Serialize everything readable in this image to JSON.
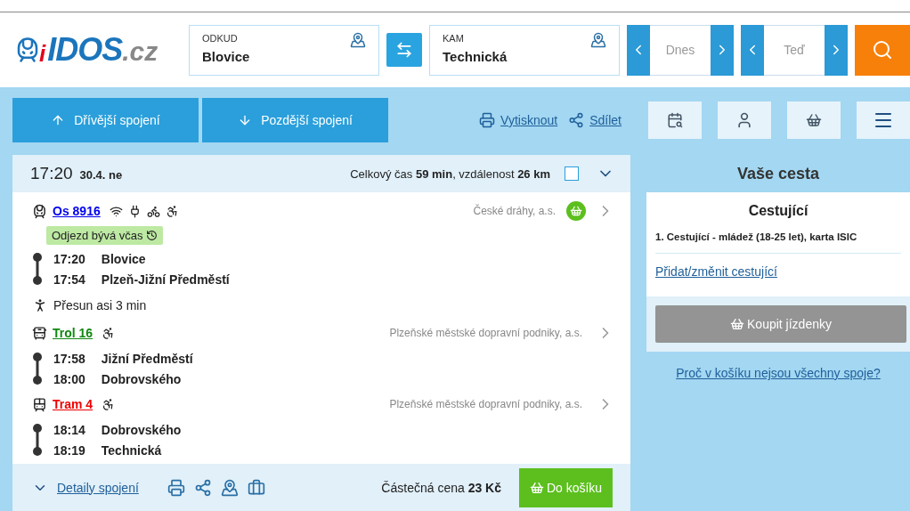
{
  "logo": {
    "mark": "i",
    "name": "IDOS",
    "domain": ".cz"
  },
  "search": {
    "from": {
      "label": "ODKUD",
      "value": "Blovice"
    },
    "to": {
      "label": "KAM",
      "value": "Technická"
    },
    "date": "Dnes",
    "time": "Teď"
  },
  "nav": {
    "earlier": "Dřívější spojení",
    "later": "Pozdější spojení",
    "print": "Vytisknout",
    "share": "Sdílet"
  },
  "connection": {
    "time": "17:20",
    "date": "30.4. ne",
    "summary": "Celkový čas **59 min**, vzdálenost **26 km**",
    "checked": false,
    "segments": [
      {
        "kind": "train",
        "line": "Os 8916",
        "color": "#0000ee",
        "amenities": [
          {
            "kind": "wifi"
          },
          {
            "kind": "socket"
          },
          {
            "kind": "bike"
          },
          {
            "kind": "wheelchair"
          }
        ],
        "operator": "České dráhy, a.s.",
        "buyable": true,
        "badge": "Odjezd bývá včas",
        "stops": [
          {
            "time": "17:20",
            "name": "Blovice"
          },
          {
            "time": "17:54",
            "name": "Plzeň-Jižní Předměstí"
          }
        ]
      },
      {
        "kind": "walk",
        "text": "Přesun asi 3 min"
      },
      {
        "kind": "trolley",
        "line": "Trol 16",
        "color": "#118811",
        "amenities": [
          {
            "kind": "wheelchair"
          }
        ],
        "operator": "Plzeňské městské dopravní podniky, a.s.",
        "stops": [
          {
            "time": "17:58",
            "name": "Jižní Předměstí"
          },
          {
            "time": "18:00",
            "name": "Dobrovského"
          }
        ]
      },
      {
        "kind": "tram",
        "line": "Tram 4",
        "color": "#ee0000",
        "amenities": [
          {
            "kind": "wheelchair"
          }
        ],
        "operator": "Plzeňské městské dopravní podniky, a.s.",
        "stops": [
          {
            "time": "18:14",
            "name": "Dobrovského"
          },
          {
            "time": "18:19",
            "name": "Technická"
          }
        ]
      }
    ],
    "details": "Detaily spojení",
    "price": "Částečná cena **23 Kč**",
    "cart": "Do košíku"
  },
  "trip": {
    "title": "Vaše cesta",
    "heading": "Cestující",
    "passenger": "1. Cestující - mládež (18-25 let), karta ISIC",
    "change": "Přidat/změnit cestující",
    "buy": {
      "label": "Koupit jízdenky",
      "disabled": true
    },
    "why": "Proč v košíku nejsou všechny spoje?"
  }
}
